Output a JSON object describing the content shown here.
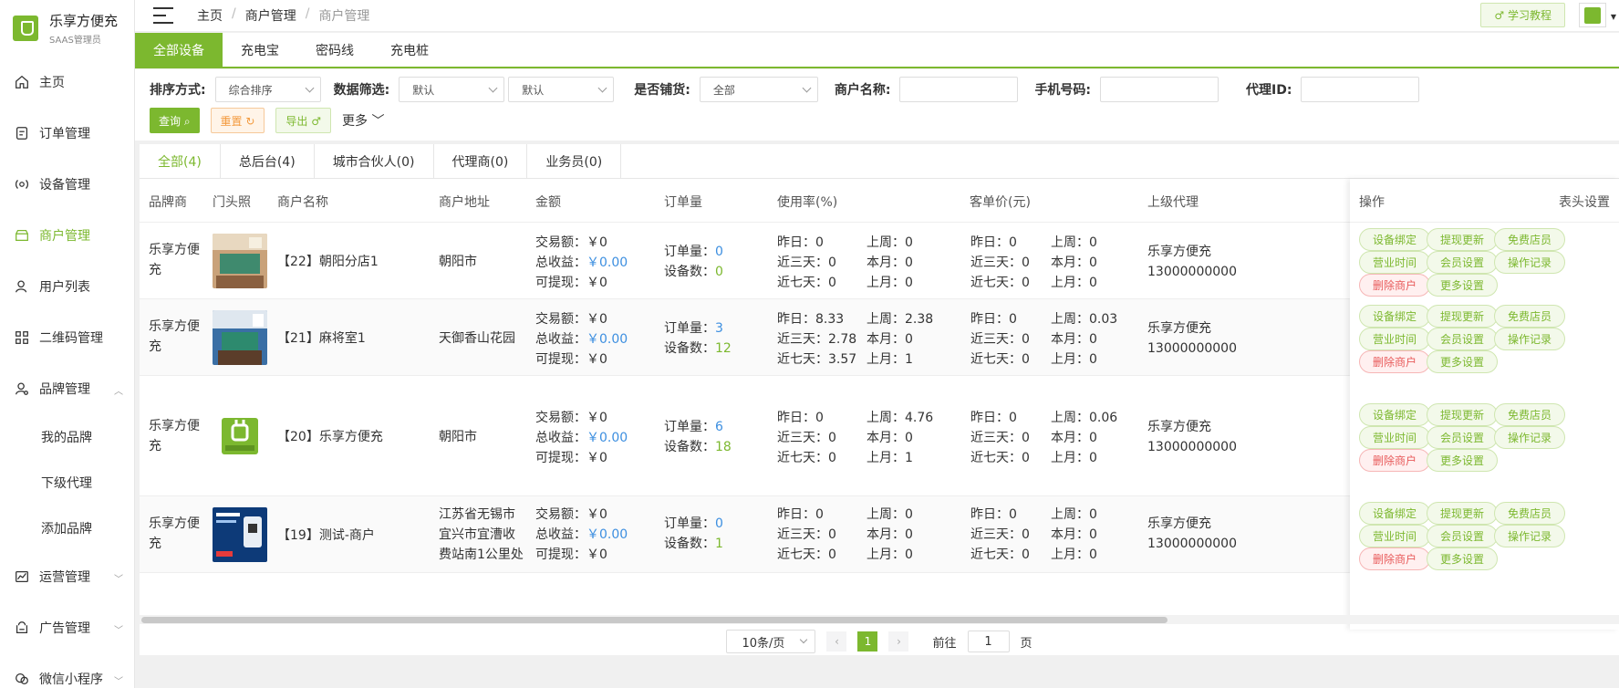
{
  "brand": {
    "title": "乐享方便充",
    "subtitle": "SAAS管理员"
  },
  "sidebar": {
    "items": [
      {
        "label": "主页",
        "icon": "home-icon"
      },
      {
        "label": "订单管理",
        "icon": "order-icon"
      },
      {
        "label": "设备管理",
        "icon": "device-icon"
      },
      {
        "label": "商户管理",
        "icon": "merchant-icon",
        "active": true
      },
      {
        "label": "用户列表",
        "icon": "user-icon"
      },
      {
        "label": "二维码管理",
        "icon": "qrcode-icon"
      },
      {
        "label": "品牌管理",
        "icon": "brand-icon"
      },
      {
        "label": "运营管理",
        "icon": "chart-icon"
      },
      {
        "label": "广告管理",
        "icon": "ad-icon"
      },
      {
        "label": "微信小程序",
        "icon": "wechat-icon"
      }
    ],
    "brand_sub": [
      "我的品牌",
      "下级代理",
      "添加品牌"
    ]
  },
  "header": {
    "breadcrumb": [
      "主页",
      "商户管理",
      "商户管理"
    ],
    "separator": "/",
    "tutorial_label": "♂ 学习教程"
  },
  "device_tabs": [
    "全部设备",
    "充电宝",
    "密码线",
    "充电桩"
  ],
  "filters": {
    "sort_label": "排序方式:",
    "sort_value": "综合排序",
    "data_label": "数据筛选:",
    "data_value_1": "默认",
    "data_value_2": "默认",
    "supply_label": "是否铺货:",
    "supply_value": "全部",
    "merchant_name_label": "商户名称:",
    "phone_label": "手机号码:",
    "agent_label": "代理ID:",
    "query_label": "查询 ⌕",
    "reset_label": "重置 ↻",
    "export_label": "导出 ♂",
    "more_label": "更多"
  },
  "merchant_tabs": [
    "全部(4)",
    "总后台(4)",
    "城市合伙人(0)",
    "代理商(0)",
    "业务员(0)"
  ],
  "table": {
    "columns": [
      "品牌商",
      "门头照",
      "商户名称",
      "商户地址",
      "金额",
      "订单量",
      "使用率(%)",
      "客单价(元)",
      "上级代理"
    ],
    "ops_header": "操作",
    "settings_header": "表头设置",
    "label_trade": "交易额：",
    "label_income": "总收益：",
    "label_withdraw": "可提现：",
    "label_orders": "订单量：",
    "label_devices": "设备数：",
    "label_yesterday": "昨日：",
    "label_last3": "近三天：",
    "label_last7": "近七天：",
    "label_lastweek": "上周：",
    "label_thismonth": "本月：",
    "label_lastmonth": "上月：",
    "rows": [
      {
        "brand": "乐享方便充",
        "name": "【22】朝阳分店1",
        "address": "朝阳市",
        "trade": "￥0",
        "income": "￥0.00",
        "withdraw": "￥0",
        "orders": "0",
        "devices": "0",
        "usage": {
          "yesterday": "0",
          "last3": "0",
          "last7": "0",
          "lastweek": "0",
          "thismonth": "0",
          "lastmonth": "0"
        },
        "price": {
          "yesterday": "0",
          "last3": "0",
          "last7": "0",
          "lastweek": "0",
          "thismonth": "0",
          "lastmonth": "0"
        },
        "agent_name": "乐享方便充",
        "agent_phone": "13000000000"
      },
      {
        "brand": "乐享方便充",
        "name": "【21】麻将室1",
        "address": "天御香山花园",
        "trade": "￥0",
        "income": "￥0.00",
        "withdraw": "￥0",
        "orders": "3",
        "devices": "12",
        "usage": {
          "yesterday": "8.33",
          "last3": "2.78",
          "last7": "3.57",
          "lastweek": "2.38",
          "thismonth": "0",
          "lastmonth": "1"
        },
        "price": {
          "yesterday": "0",
          "last3": "0",
          "last7": "0",
          "lastweek": "0.03",
          "thismonth": "0",
          "lastmonth": "0"
        },
        "agent_name": "乐享方便充",
        "agent_phone": "13000000000"
      },
      {
        "brand": "乐享方便充",
        "name": "【20】乐享方便充",
        "address": "朝阳市",
        "trade": "￥0",
        "income": "￥0.00",
        "withdraw": "￥0",
        "orders": "6",
        "devices": "18",
        "usage": {
          "yesterday": "0",
          "last3": "0",
          "last7": "0",
          "lastweek": "4.76",
          "thismonth": "0",
          "lastmonth": "1"
        },
        "price": {
          "yesterday": "0",
          "last3": "0",
          "last7": "0",
          "lastweek": "0.06",
          "thismonth": "0",
          "lastmonth": "0"
        },
        "agent_name": "乐享方便充",
        "agent_phone": "13000000000"
      },
      {
        "brand": "乐享方便充",
        "name": "【19】测试-商户",
        "address": "江苏省无锡市宜兴市宜漕收费站南1公里处",
        "trade": "￥0",
        "income": "￥0.00",
        "withdraw": "￥0",
        "orders": "0",
        "devices": "1",
        "usage": {
          "yesterday": "0",
          "last3": "0",
          "last7": "0",
          "lastweek": "0",
          "thismonth": "0",
          "lastmonth": "0"
        },
        "price": {
          "yesterday": "0",
          "last3": "0",
          "last7": "0",
          "lastweek": "0",
          "thismonth": "0",
          "lastmonth": "0"
        },
        "agent_name": "乐享方便充",
        "agent_phone": "13000000000"
      }
    ],
    "ops_buttons": [
      "设备绑定",
      "提现更新",
      "免费店员",
      "营业时间",
      "会员设置",
      "操作记录",
      "删除商户",
      "更多设置"
    ]
  },
  "pagination": {
    "page_size": "10条/页",
    "current_page": "1",
    "goto_label": "前往",
    "goto_value": "1",
    "page_suffix": "页"
  },
  "colors": {
    "accent": "#7cb82f",
    "link": "#3d8fe0",
    "danger": "#e85a5a"
  }
}
